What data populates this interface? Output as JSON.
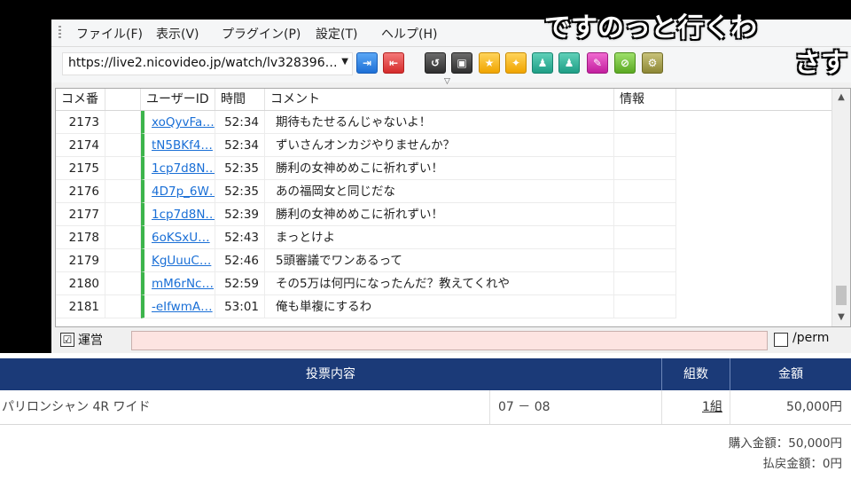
{
  "menu": [
    "ファイル(F)",
    "表示(V)",
    "プラグイン(P)",
    "設定(T)",
    "ヘルプ(H)"
  ],
  "url": "https://live2.nicovideo.jp/watch/lv328396…",
  "toolbar_icons": [
    "connect-icon",
    "disconnect-icon",
    "reload-icon",
    "window-icon",
    "star-icon",
    "star-all-icon",
    "user-icon",
    "users-icon",
    "pen-icon",
    "off-icon",
    "gear-icon"
  ],
  "columns": [
    "コメ番",
    "ユーザーID",
    "時間",
    "コメント",
    "情報"
  ],
  "comments": [
    {
      "no": "2173",
      "user": "xoQyvFa…",
      "time": "52:34",
      "text": "期待もたせるんじゃないよ！"
    },
    {
      "no": "2174",
      "user": "tN5BKf4…",
      "time": "52:34",
      "text": "ずいさんオンカジやりませんか？"
    },
    {
      "no": "2175",
      "user": "1cp7d8N…",
      "time": "52:35",
      "text": "勝利の女神めめこに祈れずい！"
    },
    {
      "no": "2176",
      "user": "4D7p_6W…",
      "time": "52:35",
      "text": "あの福岡女と同じだな"
    },
    {
      "no": "2177",
      "user": "1cp7d8N…",
      "time": "52:39",
      "text": "勝利の女神めめこに祈れずい！"
    },
    {
      "no": "2178",
      "user": "6oKSxU…",
      "time": "52:43",
      "text": "まっとけよ"
    },
    {
      "no": "2179",
      "user": "KgUuuC…",
      "time": "52:46",
      "text": "5頭審議でワンあるって"
    },
    {
      "no": "2180",
      "user": "mM6rNc…",
      "time": "52:59",
      "text": "その5万は何円になったんだ？教えてくれや"
    },
    {
      "no": "2181",
      "user": "-eIfwmA…",
      "time": "53:01",
      "text": "俺も単複にするわ"
    }
  ],
  "checkbox_label": "運営",
  "checkbox_mark": "☑",
  "perm_label": "/perm",
  "overlay": {
    "line1": "ですのっと行くわ",
    "line2": "さす"
  },
  "bet": {
    "headers": [
      "投票内容",
      "組数",
      "金額"
    ],
    "row": {
      "content": "パリロンシャン 4R ワイド",
      "combo": "07 － 08",
      "count": "1組",
      "amount": "50,000円"
    },
    "purchase": "購入金額：50,000円",
    "refund": "払戻金額：0円"
  }
}
